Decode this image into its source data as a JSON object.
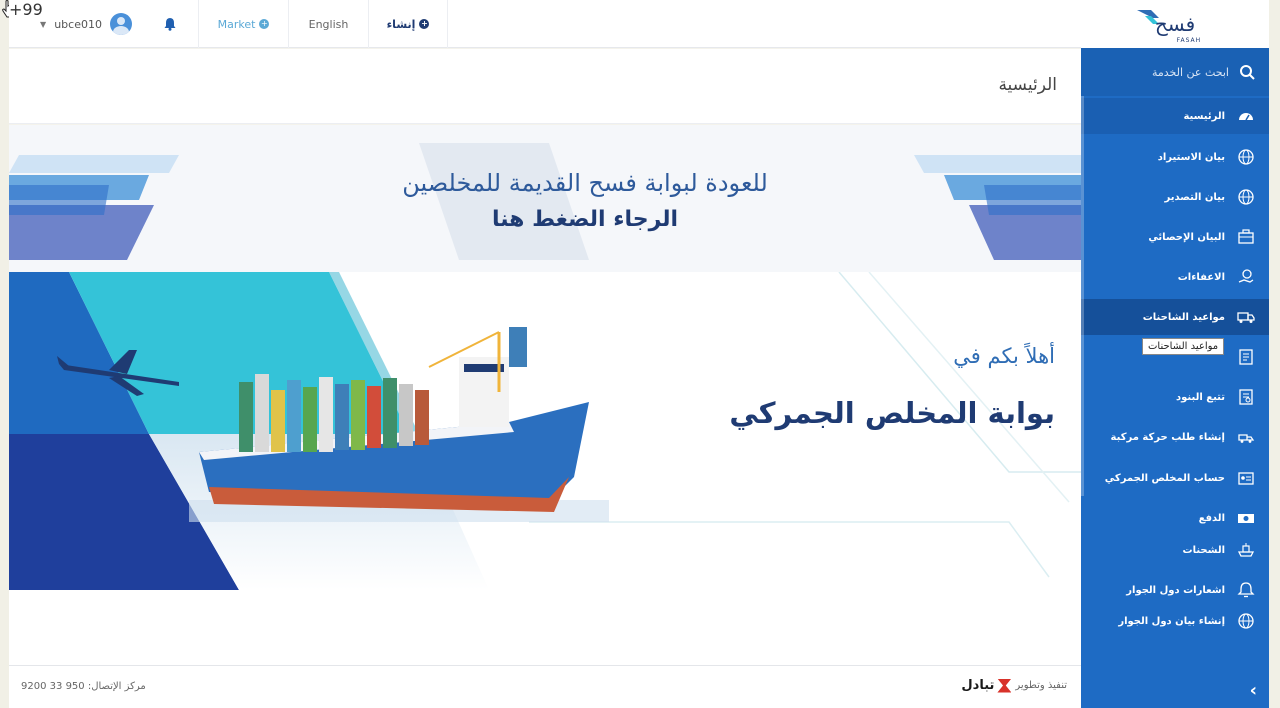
{
  "topbar": {
    "username": "ubce010",
    "notifications_badge": "+99",
    "market_label": "Market",
    "language_label": "English",
    "create_label": "إنشاء"
  },
  "page": {
    "title": "الرئيسية"
  },
  "announcement": {
    "line1": "للعودة لبوابة فسح القديمة للمخلصين",
    "line2": "الرجاء الضغط هنا"
  },
  "hero": {
    "welcome": "أهلاً بكم في",
    "portal_name": "بوابة المخلص الجمركي"
  },
  "footer": {
    "contact": "مركز الإتصال: 950 33 9200",
    "credit": "تنفيذ وتطوير",
    "partner": "تبادل"
  },
  "sidebar": {
    "logo_text": "فسح",
    "logo_sub": "FASAH",
    "search_placeholder": "ابحث عن الخدمة",
    "items": [
      {
        "label": "الرئيسية",
        "icon": "dashboard-icon"
      },
      {
        "label": "بيان الاستيراد",
        "icon": "globe-icon"
      },
      {
        "label": "بيان التصدير",
        "icon": "globe-icon"
      },
      {
        "label": "البيان الإحصائي",
        "icon": "briefcase-icon"
      },
      {
        "label": "الاعفاءات",
        "icon": "hand-coin-icon"
      },
      {
        "label": "مواعيد الشاحنات",
        "icon": "truck-icon"
      },
      {
        "label": "",
        "icon": "document-icon"
      },
      {
        "label": "تتبع البنود",
        "icon": "document-search-icon"
      },
      {
        "label": "إنشاء طلب حركة مركبة",
        "icon": "vehicle-icon"
      },
      {
        "label": "حساب المخلص الجمركي",
        "icon": "id-card-icon"
      },
      {
        "label": "الدفع",
        "icon": "money-icon"
      },
      {
        "label": "الشحنات",
        "icon": "ship-icon"
      },
      {
        "label": "اشعارات دول الجوار",
        "icon": "bell-icon"
      },
      {
        "label": "إنشاء بيان دول الجوار",
        "icon": "globe-icon"
      }
    ],
    "tooltip": "مواعيد الشاحنات"
  },
  "colors": {
    "sidebar": "#1e6bc4",
    "brand_dark": "#1f3b73",
    "accent_cyan": "#34c3d8",
    "badge": "#e84c3d"
  }
}
